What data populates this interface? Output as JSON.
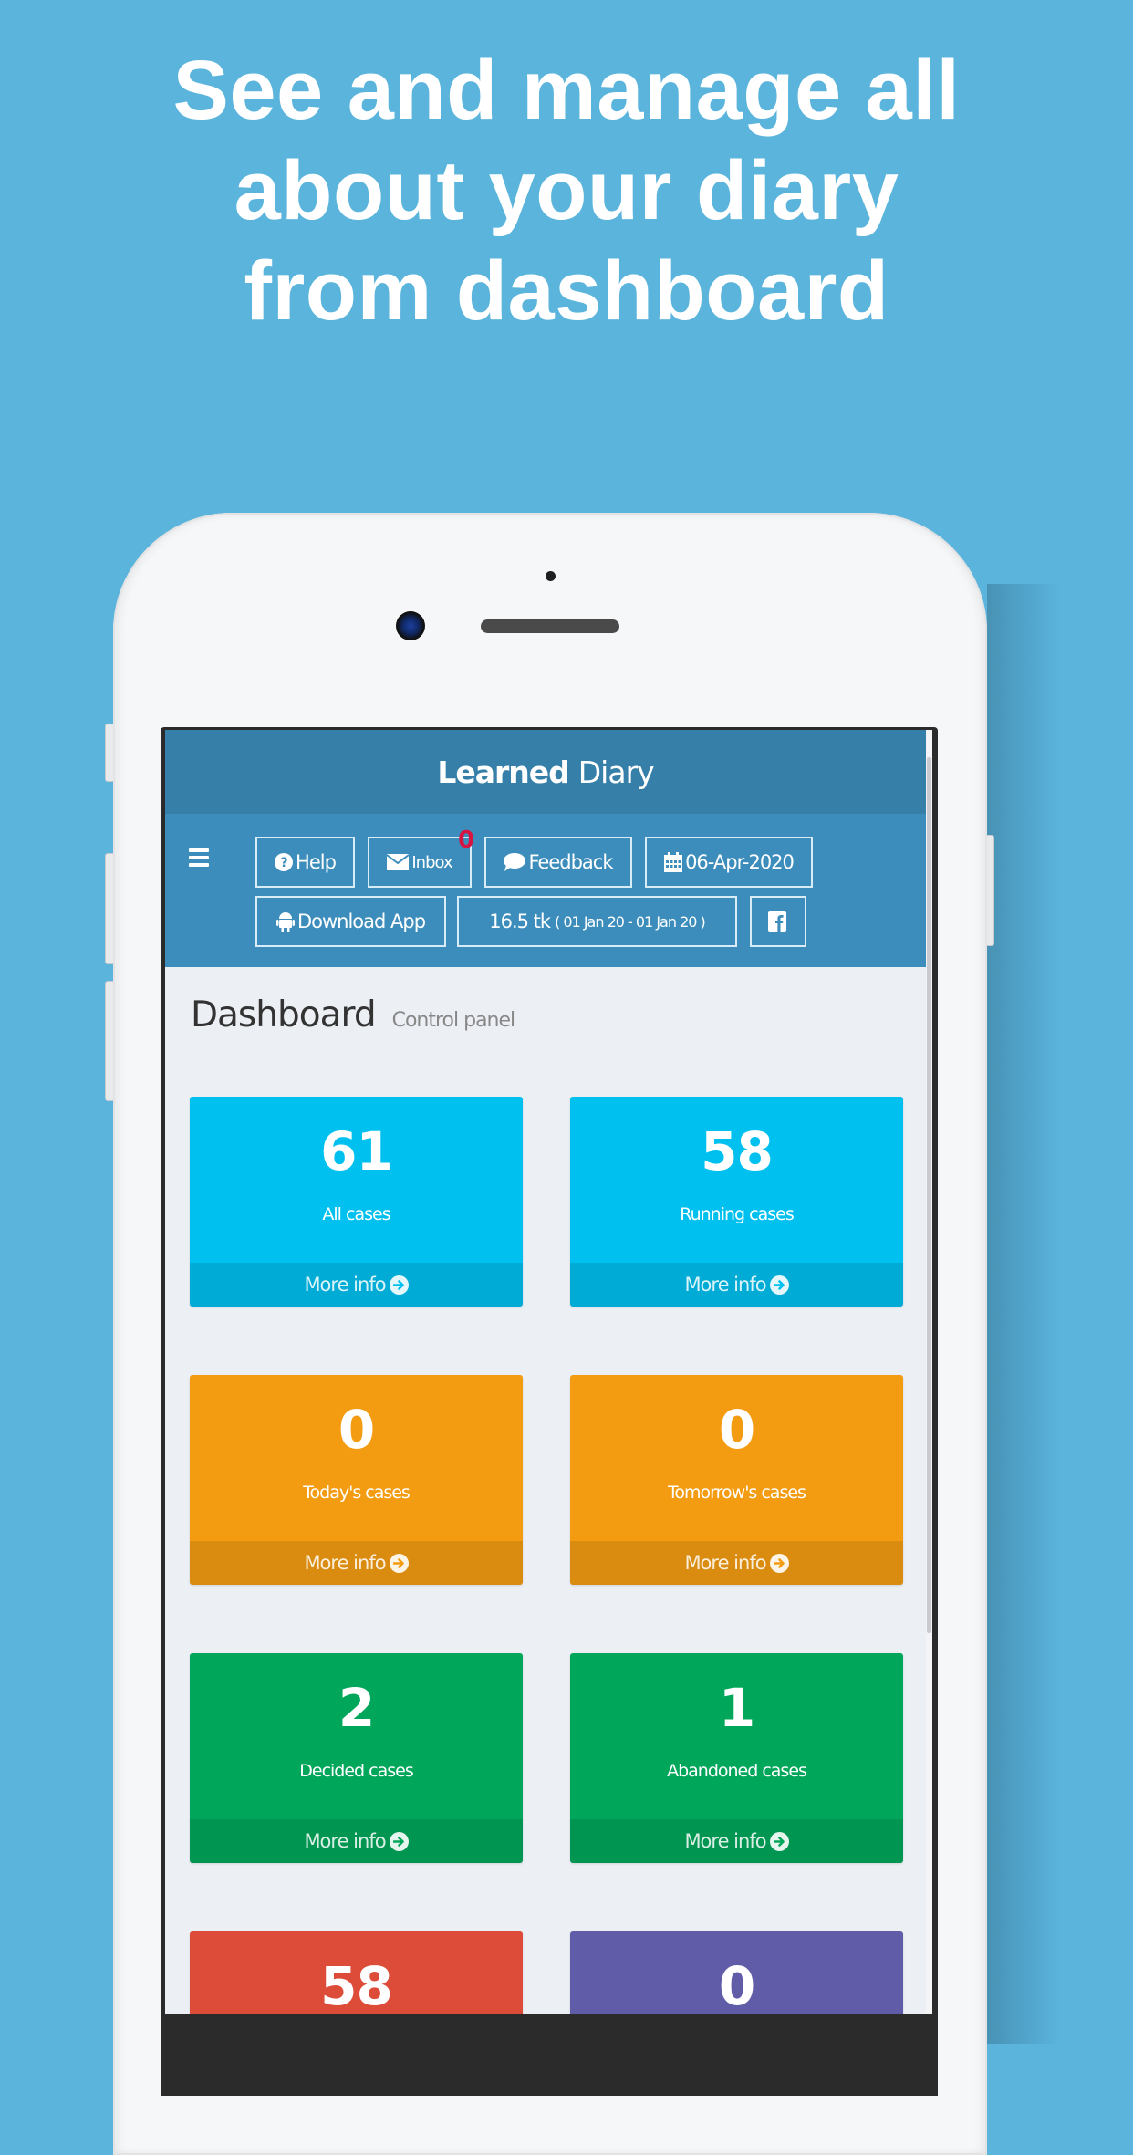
{
  "headline": {
    "lines": [
      "See and manage all",
      "about your diary",
      "from dashboard"
    ]
  },
  "app": {
    "title_bold": "Learned",
    "title_regular": "Diary",
    "nav": {
      "menu_icon": "hamburger-icon",
      "help": {
        "label": "Help",
        "icon": "question-circle-icon"
      },
      "inbox": {
        "label": "Inbox",
        "icon": "envelope-icon",
        "badge": "0"
      },
      "feedback": {
        "label": "Feedback",
        "icon": "comment-icon"
      },
      "date": {
        "label": "06-Apr-2020",
        "icon": "calendar-icon"
      },
      "download": {
        "label": "Download App",
        "icon": "android-icon"
      },
      "balance": {
        "amount": "16.5 tk",
        "period": "( 01 Jan 20 - 01 Jan 20 )"
      },
      "facebook": {
        "icon": "facebook-icon"
      }
    },
    "page_title": "Dashboard",
    "page_subtitle": "Control panel",
    "more_info_label": "More info",
    "cards": [
      {
        "value": "61",
        "label": "All cases",
        "color": "#00c0ef"
      },
      {
        "value": "58",
        "label": "Running cases",
        "color": "#00c0ef"
      },
      {
        "value": "0",
        "label": "Today's cases",
        "color": "#f39c12"
      },
      {
        "value": "0",
        "label": "Tomorrow's cases",
        "color": "#f39c12"
      },
      {
        "value": "2",
        "label": "Decided cases",
        "color": "#00a65a"
      },
      {
        "value": "1",
        "label": "Abandoned cases",
        "color": "#00a65a"
      },
      {
        "value": "58",
        "label": "",
        "color": "#dd4b39"
      },
      {
        "value": "0",
        "label": "",
        "color": "#605ca8"
      }
    ]
  },
  "colors": {
    "background": "#5ab4dc",
    "title_bar": "#367fa9",
    "nav_bar": "#3c8dbc",
    "badge": "#d81442",
    "content_bg": "#ecf0f5"
  }
}
